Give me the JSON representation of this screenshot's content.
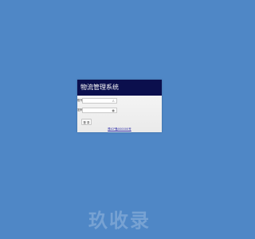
{
  "header": {
    "title": "物流管理系统"
  },
  "form": {
    "username_label": "账号",
    "password_label": "密码",
    "username_value": "",
    "password_value": "",
    "login_label": "登 录"
  },
  "footer": {
    "link_text": "豫ICP备000000号"
  },
  "watermark": {
    "text": "玖收录"
  },
  "colors": {
    "page_background": "#4f87c6",
    "header_background": "#0b0f4d",
    "panel_background": "#eeeeee"
  }
}
